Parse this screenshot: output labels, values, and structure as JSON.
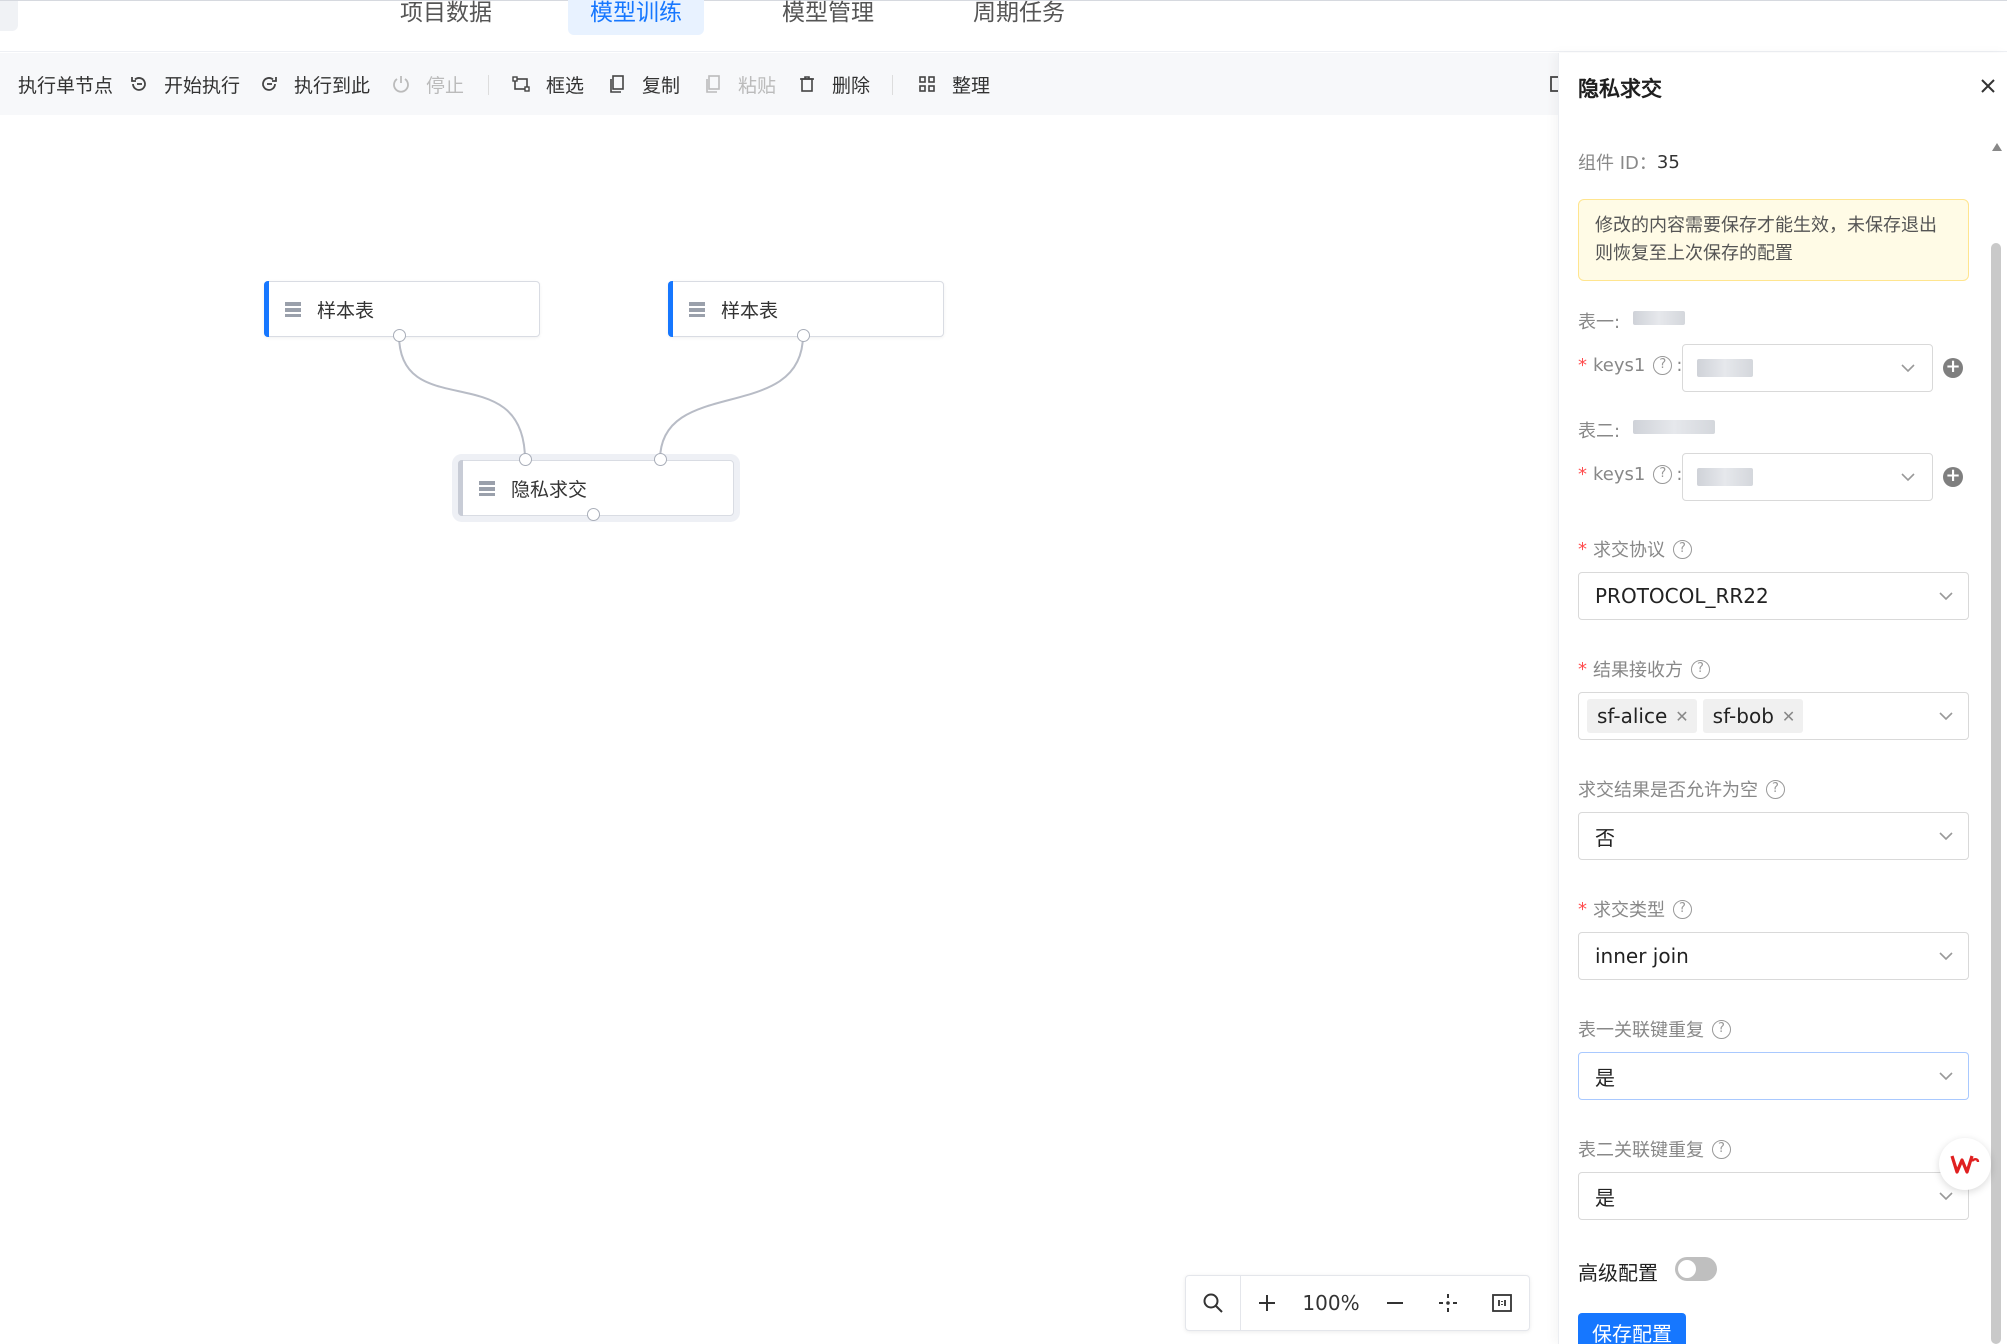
{
  "nav": {
    "tabs": [
      {
        "label": "项目数据"
      },
      {
        "label": "模型训练"
      },
      {
        "label": "模型管理"
      },
      {
        "label": "周期任务"
      }
    ],
    "active_tab": "模型训练"
  },
  "toolbar": {
    "run_single": "执行单节点",
    "start_run": "开始执行",
    "run_to_here": "执行到此",
    "stop": "停止",
    "box_select": "框选",
    "copy": "复制",
    "paste": "粘贴",
    "delete": "删除",
    "arrange": "整理"
  },
  "canvas": {
    "nodes": [
      {
        "label": "样本表"
      },
      {
        "label": "样本表"
      },
      {
        "label": "隐私求交"
      }
    ]
  },
  "zoom": {
    "value": "100%"
  },
  "panel": {
    "title": "隐私求交",
    "component_id_label": "组件 ID：",
    "component_id": "35",
    "notice": "修改的内容需要保存才能生效，未保存退出则恢复至上次保存的配置",
    "table1_label": "表一:",
    "table2_label": "表二:",
    "keys_label": "keys1",
    "protocol_label": "求交协议",
    "protocol_value": "PROTOCOL_RR22",
    "receiver_label": "结果接收方",
    "receivers": [
      "sf-alice",
      "sf-bob"
    ],
    "allow_empty_label": "求交结果是否允许为空",
    "allow_empty_value": "否",
    "join_type_label": "求交类型",
    "join_type_value": "inner join",
    "table1_dup_label": "表一关联键重复",
    "table1_dup_value": "是",
    "table2_dup_label": "表二关联键重复",
    "table2_dup_value": "是",
    "advanced_label": "高级配置",
    "advanced_enabled": false,
    "save_label": "保存配置"
  },
  "colors": {
    "accent": "#1677ff",
    "required": "#ff4d4f",
    "notice_bg": "#fffbe6"
  }
}
